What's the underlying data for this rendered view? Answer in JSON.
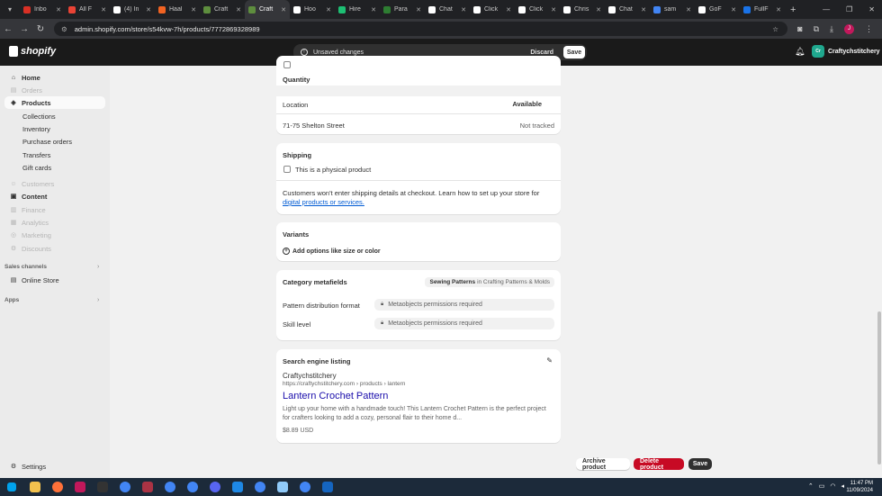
{
  "browser": {
    "tabs": [
      {
        "label": "Inbo",
        "color": "#d93025"
      },
      {
        "label": "All F",
        "color": "#ea4335"
      },
      {
        "label": "(4) In",
        "color": "#ffffff"
      },
      {
        "label": "Haal",
        "color": "#f26322"
      },
      {
        "label": "Craft",
        "color": "#5e8e3e"
      },
      {
        "label": "Craft",
        "color": "#5e8e3e",
        "active": true
      },
      {
        "label": "Hoo",
        "color": "#ffffff"
      },
      {
        "label": "Hire",
        "color": "#1dbf73"
      },
      {
        "label": "Para",
        "color": "#2e7d32"
      },
      {
        "label": "Chat",
        "color": "#ffffff"
      },
      {
        "label": "Click",
        "color": "#ffffff"
      },
      {
        "label": "Click",
        "color": "#ffffff"
      },
      {
        "label": "Chris",
        "color": "#ffffff"
      },
      {
        "label": "Chat",
        "color": "#ffffff"
      },
      {
        "label": "sam",
        "color": "#4285f4"
      },
      {
        "label": "GoF",
        "color": "#ffffff"
      },
      {
        "label": "FullF",
        "color": "#1a73e8"
      }
    ],
    "url": "admin.shopify.com/store/s54kvw-7h/products/7772869328989",
    "profile_initial": "J"
  },
  "shopify": {
    "logo_text": "shopify",
    "unsaved_text": "Unsaved changes",
    "discard_label": "Discard",
    "save_label": "Save",
    "store_initials": "Cr",
    "store_name": "Craftychstitchery"
  },
  "sidebar": {
    "home": "Home",
    "orders": "Orders",
    "products": "Products",
    "collections": "Collections",
    "inventory": "Inventory",
    "purchase_orders": "Purchase orders",
    "transfers": "Transfers",
    "gift_cards": "Gift cards",
    "customers": "Customers",
    "content": "Content",
    "finance": "Finance",
    "analytics": "Analytics",
    "marketing": "Marketing",
    "discounts": "Discounts",
    "sales_channels": "Sales channels",
    "online_store": "Online Store",
    "apps": "Apps",
    "settings": "Settings"
  },
  "inventory": {
    "quantity_title": "Quantity",
    "location_header": "Location",
    "available_header": "Available",
    "location": "71-75 Shelton Street",
    "available": "Not tracked"
  },
  "shipping": {
    "title": "Shipping",
    "physical_label": "This is a physical product",
    "note_prefix": "Customers won't enter shipping details at checkout. Learn how to set up your store for ",
    "note_link": "digital products or services."
  },
  "variants": {
    "title": "Variants",
    "add_label": "Add options like size or color"
  },
  "metafields": {
    "title": "Category metafields",
    "category_bold": "Sewing Patterns",
    "category_rest": "in Crafting Patterns & Molds",
    "rows": [
      {
        "label": "Pattern distribution format",
        "value": "Metaobjects permissions required"
      },
      {
        "label": "Skill level",
        "value": "Metaobjects permissions required"
      }
    ]
  },
  "seo": {
    "title": "Search engine listing",
    "store": "Craftychstitchery",
    "url": "https://craftychstitchery.com › products › lantern",
    "page_title": "Lantern Crochet Pattern",
    "description": "Light up your home with a handmade touch! This Lantern Crochet Pattern is the perfect project for crafters looking to add a cozy, personal flair to their home d...",
    "price": "$8.89 USD"
  },
  "actions": {
    "archive": "Archive product",
    "delete": "Delete product",
    "save": "Save"
  },
  "taskbar": {
    "time": "11:47 PM",
    "date": "11/09/2024"
  }
}
